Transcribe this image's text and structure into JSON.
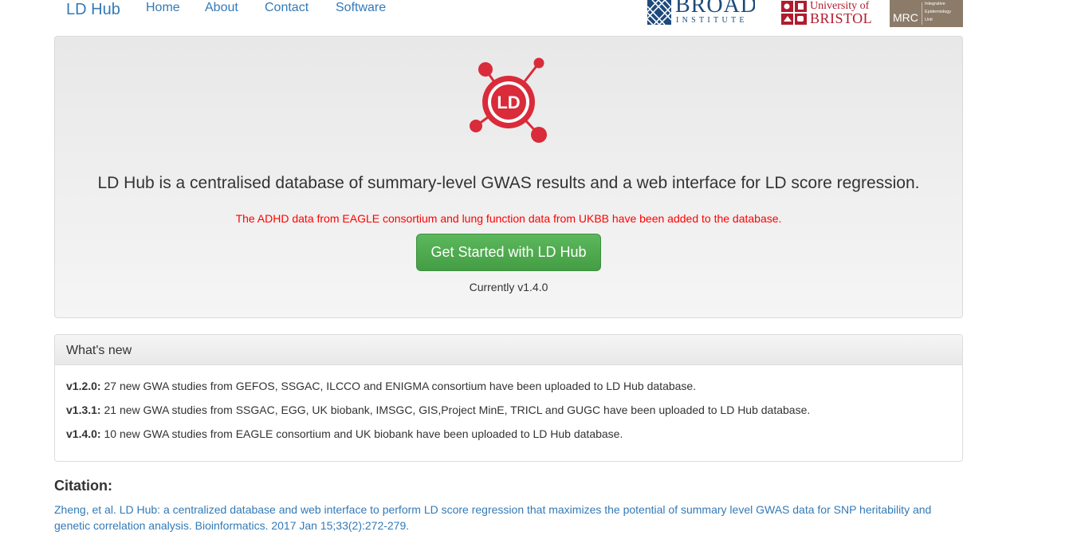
{
  "navbar": {
    "brand": "LD Hub",
    "links": [
      "Home",
      "About",
      "Contact",
      "Software"
    ]
  },
  "partners": {
    "broad": {
      "name": "BROAD",
      "sub": "INSTITUTE",
      "color": "#1d4a7c"
    },
    "bristol": {
      "line1": "University of",
      "line2": "BRISTOL",
      "color": "#b01c2e"
    },
    "mrc": {
      "name": "MRC",
      "lines": [
        "Integrative",
        "Epidemiology",
        "Unit"
      ],
      "color": "#8c7b69"
    }
  },
  "hero": {
    "logo_icon": "ld-hub-logo-icon",
    "logo_text": "LD",
    "logo_color": "#d92b3a",
    "lead": "LD Hub is a centralised database of summary-level GWAS results and a web interface for LD score regression.",
    "notice": "The ADHD data from EAGLE consortium and lung function data from UKBB have been added to the database.",
    "notice_color": "#ff0000",
    "button_label": "Get Started with LD Hub",
    "button_color": "#5cb85c",
    "version": "Currently v1.4.0"
  },
  "whats_new": {
    "title": "What's new",
    "items": [
      {
        "version": "v1.2.0:",
        "text": " 27 new GWA studies from GEFOS, SSGAC, ILCCO and ENIGMA consortium have been uploaded to LD Hub database."
      },
      {
        "version": "v1.3.1:",
        "text": " 21 new GWA studies from SSGAC, EGG, UK biobank, IMSGC, GIS,Project MinE, TRICL and GUGC have been uploaded to LD Hub database."
      },
      {
        "version": "v1.4.0:",
        "text": " 10 new GWA studies from EAGLE consortium and UK biobank have been uploaded to LD Hub database."
      }
    ]
  },
  "citation": {
    "title": "Citation:",
    "text": "Zheng, et al. LD Hub: a centralized database and web interface to perform LD score regression that maximizes the potential of summary level GWAS data for SNP heritability and genetic correlation analysis. Bioinformatics. 2017 Jan 15;33(2):272-279."
  }
}
